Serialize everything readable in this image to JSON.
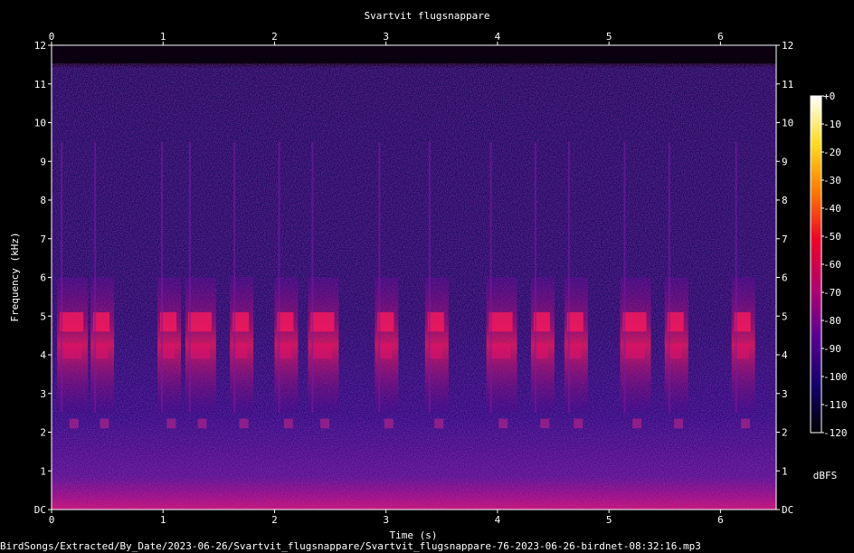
{
  "chart_data": {
    "type": "heatmap",
    "title": "Svartvit flugsnappare",
    "xlabel": "Time (s)",
    "ylabel": "Frequency (kHz)",
    "xlim": [
      0,
      6.5
    ],
    "ylim": [
      0,
      12
    ],
    "x_ticks": [
      "0",
      "1",
      "2",
      "3",
      "4",
      "5",
      "6"
    ],
    "x_tick_values": [
      0,
      1,
      2,
      3,
      4,
      5,
      6
    ],
    "y_ticks": [
      "DC",
      "1",
      "2",
      "3",
      "4",
      "5",
      "6",
      "7",
      "8",
      "9",
      "10",
      "11",
      "12"
    ],
    "y_tick_values": [
      0,
      1,
      2,
      3,
      4,
      5,
      6,
      7,
      8,
      9,
      10,
      11,
      12
    ],
    "colorbar": {
      "label": "dBFS",
      "ticks": [
        "+0",
        "-10",
        "-20",
        "-30",
        "-40",
        "-50",
        "-60",
        "-70",
        "-80",
        "-90",
        "-100",
        "-110",
        "-120"
      ],
      "tick_values": [
        0,
        -10,
        -20,
        -30,
        -40,
        -50,
        -60,
        -70,
        -80,
        -90,
        -100,
        -110,
        -120
      ],
      "range": [
        -120,
        0
      ],
      "colors": [
        "#000000",
        "#14006e",
        "#5a0094",
        "#b4006e",
        "#f00028",
        "#ff7800",
        "#ffdc1e",
        "#ffffff"
      ]
    },
    "song_onsets_s": [
      0.05,
      0.35,
      0.95,
      1.2,
      1.6,
      2.0,
      2.3,
      2.9,
      3.35,
      3.9,
      4.3,
      4.6,
      5.1,
      5.5,
      6.1
    ],
    "song_band_khz": [
      2.5,
      6.0
    ],
    "grid": false,
    "legend": "none"
  },
  "footer": {
    "file_path": "BirdSongs/Extracted/By_Date/2023-06-26/Svartvit_flugsnappare/Svartvit_flugsnappare-76-2023-06-26-birdnet-08:32:16.mp3"
  }
}
